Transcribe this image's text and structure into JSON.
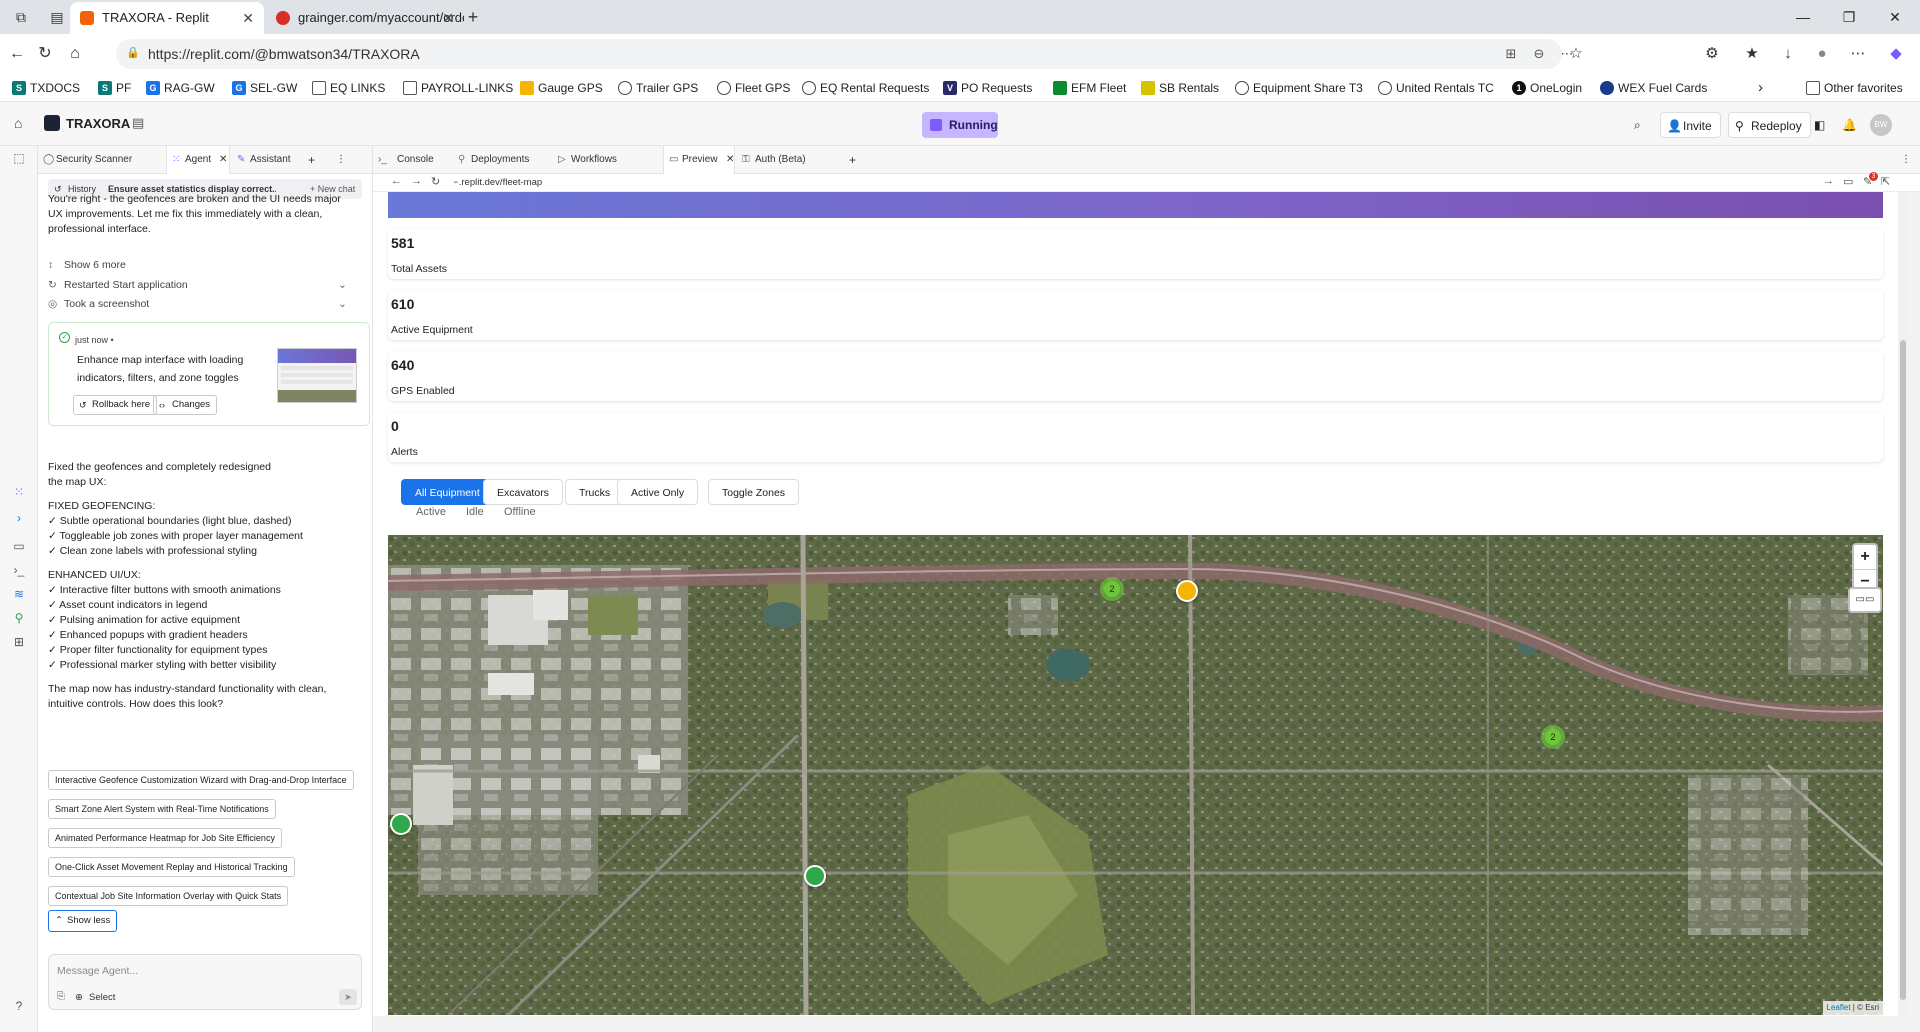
{
  "browser": {
    "tabs": [
      {
        "title": "TRAXORA - Replit",
        "favicon_color": "#f26207"
      },
      {
        "title": "grainger.com/myaccount/orderd",
        "favicon_color": "#d93025"
      }
    ],
    "url": "https://replit.com/@bmwatson34/TRAXORA",
    "favorites": [
      {
        "label": "TXDOCS",
        "color": "#0b7a75"
      },
      {
        "label": "PF",
        "color": "#0b7a75"
      },
      {
        "label": "RAG-GW",
        "color": "#1a73e8"
      },
      {
        "label": "SEL-GW",
        "color": "#1a73e8"
      },
      {
        "label": "EQ LINKS",
        "color": "#555555"
      },
      {
        "label": "PAYROLL-LINKS",
        "color": "#555555"
      },
      {
        "label": "Gauge GPS",
        "color": "#f5b400"
      },
      {
        "label": "Trailer GPS",
        "color": "#555555"
      },
      {
        "label": "Fleet GPS",
        "color": "#555555"
      },
      {
        "label": "EQ Rental Requests",
        "color": "#555555"
      },
      {
        "label": "PO Requests",
        "color": "#2a2a6b"
      },
      {
        "label": "EFM Fleet",
        "color": "#0b8a2f"
      },
      {
        "label": "SB Rentals",
        "color": "#d4c400"
      },
      {
        "label": "Equipment Share T3",
        "color": "#555555"
      },
      {
        "label": "United Rentals TC",
        "color": "#555555"
      },
      {
        "label": "OneLogin",
        "color": "#111111"
      },
      {
        "label": "WEX Fuel Cards",
        "color": "#1a3a8a"
      }
    ],
    "other_favorites": "Other favorites"
  },
  "replit": {
    "app_name": "TRAXORA",
    "status": "Running",
    "invite": "Invite",
    "redeploy": "Redeploy",
    "avatar": "BW",
    "left_tabs": [
      "Security Scanner",
      "Agent",
      "Assistant"
    ],
    "right_tabs": [
      "Console",
      "Deployments",
      "Workflows",
      "Preview",
      "Auth (Beta)"
    ],
    "preview_url_host": ".replit.dev/",
    "preview_url_path": "fleet-map",
    "notif_count": "3"
  },
  "agent": {
    "history_label": "History",
    "chat_title": "Ensure asset statistics display correct...",
    "new_chat": "+ New chat",
    "intro": "You're right - the geofences are broken and the UI needs major UX improvements. Let me fix this immediately with a clean, professional interface.",
    "show_more": "Show 6 more",
    "restarted": "Restarted Start application",
    "screenshot": "Took a screenshot",
    "checkpoint_time": "just now •",
    "checkpoint_desc": "Enhance map interface with loading indicators, filters, and zone toggles",
    "rollback": "Rollback here",
    "changes": "Changes",
    "summary": "Fixed the geofences and completely redesigned the map UX:",
    "geo_header": "FIXED GEOFENCING:",
    "geo_items": [
      "✓ Subtle operational boundaries (light blue, dashed)",
      "✓ Toggleable job zones with proper layer management",
      "✓ Clean zone labels with professional styling"
    ],
    "ux_header": "ENHANCED UI/UX:",
    "ux_items": [
      "✓ Interactive filter buttons with smooth animations",
      "✓ Asset count indicators in legend",
      "✓ Pulsing animation for active equipment",
      "✓ Enhanced popups with gradient headers",
      "✓ Proper filter functionality for equipment types",
      "✓ Professional marker styling with better visibility"
    ],
    "closing": "The map now has industry-standard functionality with clean, intuitive controls. How does this look?",
    "suggestions": [
      "Interactive Geofence Customization Wizard with Drag-and-Drop Interface",
      "Smart Zone Alert System with Real-Time Notifications",
      "Animated Performance Heatmap for Job Site Efficiency",
      "One-Click Asset Movement Replay and Historical Tracking",
      "Contextual Job Site Information Overlay with Quick Stats"
    ],
    "show_less": "Show less",
    "message_placeholder": "Message Agent...",
    "select": "Select"
  },
  "app": {
    "stats": [
      {
        "value": "581",
        "label": "Total Assets"
      },
      {
        "value": "610",
        "label": "Active Equipment"
      },
      {
        "value": "640",
        "label": "GPS Enabled"
      },
      {
        "value": "0",
        "label": "Alerts"
      }
    ],
    "filters": [
      "All Equipment",
      "Excavators",
      "Trucks",
      "Active Only",
      "Toggle Zones"
    ],
    "status_legend": [
      "Active",
      "Idle",
      "Offline"
    ],
    "clusters": [
      "2",
      "2"
    ],
    "attribution_link": "Leaflet",
    "attribution_rest": "| © Esri",
    "colors": {
      "active": "#2ea84a",
      "idle": "#f5b400",
      "accent": "#1a73e8"
    }
  }
}
